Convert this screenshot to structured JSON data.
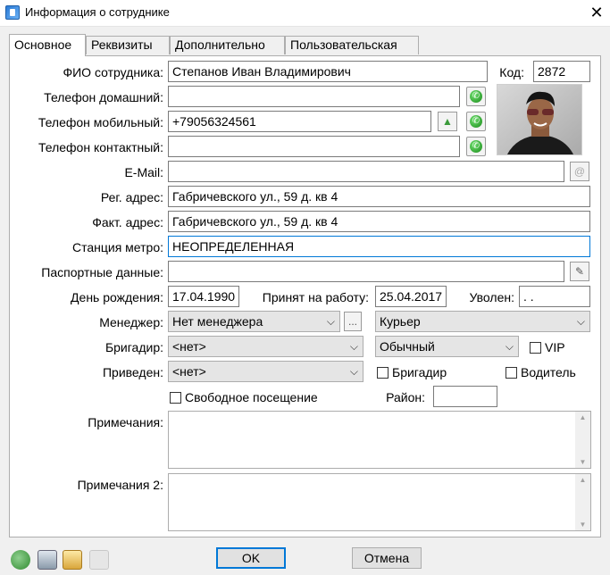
{
  "window": {
    "title": "Информация о сотруднике"
  },
  "tabs": [
    {
      "label": "Основное"
    },
    {
      "label": "Реквизиты"
    },
    {
      "label": "Дополнительно"
    },
    {
      "label": "Пользовательская"
    }
  ],
  "form": {
    "fio_label": "ФИО сотрудника:",
    "fio_value": "Степанов Иван Владимирович",
    "code_label": "Код:",
    "code_value": "2872",
    "phone_home_label": "Телефон домашний:",
    "phone_home_value": "",
    "phone_mobile_label": "Телефон мобильный:",
    "phone_mobile_value": "+79056324561",
    "phone_contact_label": "Телефон контактный:",
    "phone_contact_value": "",
    "email_label": "E-Mail:",
    "email_value": "",
    "reg_address_label": "Рег. адрес:",
    "reg_address_value": "Габричевского ул., 59 д. кв 4",
    "fact_address_label": "Факт. адрес:",
    "fact_address_value": "Габричевского ул., 59 д. кв 4",
    "metro_label": "Станция метро:",
    "metro_value": "НЕОПРЕДЕЛЕННАЯ",
    "passport_label": "Паспортные данные:",
    "passport_value": "",
    "birthday_label": "День рождения:",
    "birthday_value": "17.04.1990",
    "hired_label": "Принят на работу:",
    "hired_value": "25.04.2017",
    "fired_label": "Уволен:",
    "fired_value": " .  .",
    "manager_label": "Менеджер:",
    "manager_value": "Нет менеджера",
    "manager_btn": "...",
    "position_value": "Курьер",
    "brigadier_label": "Бригадир:",
    "brigadier_value": "<нет>",
    "type_value": "Обычный",
    "vip_label": "VIP",
    "referred_label": "Приведен:",
    "referred_value": "<нет>",
    "brigadier_check_label": "Бригадир",
    "driver_check_label": "Водитель",
    "free_visit_label": "Свободное посещение",
    "district_label": "Район:",
    "district_value": "",
    "notes_label": "Примечания:",
    "notes2_label": "Примечания 2:"
  },
  "buttons": {
    "ok": "OK",
    "cancel": "Отмена"
  },
  "icons": {
    "phone": "phone-call-icon",
    "email": "at-sign-icon",
    "passport": "pen-icon",
    "mobile_extra": "upload-icon"
  },
  "colors": {
    "accent": "#0078d7",
    "phone_green": "#1b8a1b"
  }
}
